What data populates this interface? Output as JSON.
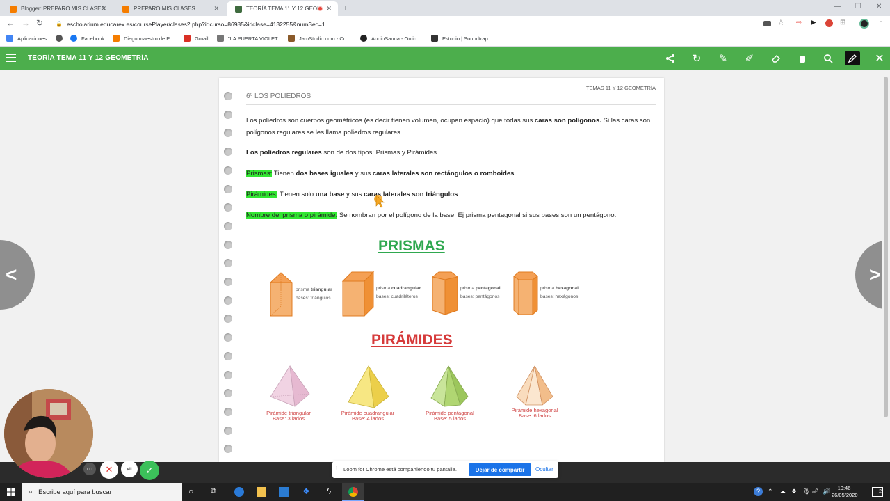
{
  "browser": {
    "tabs": [
      {
        "label": "Blogger: PREPARO MIS CLASES",
        "color": "#f57d00"
      },
      {
        "label": "PREPARO MIS CLASES",
        "color": "#f57d00"
      },
      {
        "label": "TEORÍA TEMA 11 Y 12 GEOM",
        "color": "#3f6b3f"
      }
    ],
    "url": "escholarium.educarex.es/coursePlayer/clases2.php?idcurso=86985&idclase=4132255&numSec=1",
    "bookmarks": [
      {
        "label": "Aplicaciones",
        "color": "#4285f4"
      },
      {
        "label": "",
        "color": "#555555"
      },
      {
        "label": "Facebook",
        "color": "#1877f2"
      },
      {
        "label": "Diego maestro de P...",
        "color": "#f57d00"
      },
      {
        "label": "Gmail",
        "color": "#d93025"
      },
      {
        "label": "\"LA PUERTA VIOLET...",
        "color": "#777777"
      },
      {
        "label": "JamStudio.com - Cr...",
        "color": "#8a5a2a"
      },
      {
        "label": "AudioSauna - Onlin...",
        "color": "#222222"
      },
      {
        "label": "Estudio | Soundtrap...",
        "color": "#333333"
      }
    ]
  },
  "app": {
    "title": "TEORÍA TEMA 11 Y 12 GEOMETRÍA",
    "accent": "#4cae4c",
    "toolbar_icons": [
      "share-icon",
      "refresh-icon",
      "pencil-icon",
      "marker-icon",
      "eraser-icon",
      "hand-icon",
      "search-icon",
      "pen-selected-icon",
      "close-icon"
    ]
  },
  "doc": {
    "section_title": "6º LOS POLIEDROS",
    "header_right": "TEMAS 11 Y 12 GEOMETRÍA",
    "p1": {
      "a": "Los poliedros son cuerpos geométricos (es decir tienen volumen, ocupan espacio) que todas sus ",
      "b": "caras son polígonos.",
      "c": " Si las caras son polígonos regulares se les llama poliedros regulares."
    },
    "p2": {
      "a": "Los poliedros regulares",
      "b": " son de dos tipos: Prismas y Pirámides."
    },
    "p3": {
      "hl": "Prismas:",
      "a": " Tienen ",
      "b": "dos bases iguales",
      "c": " y sus ",
      "d": "caras laterales son rectángulos o romboides"
    },
    "p4": {
      "hl": "Pirámides:",
      "a": " Tienen solo ",
      "b": "una base",
      "c": " y sus ",
      "d": "caras laterales son triángulos"
    },
    "p5": {
      "hl": "Nombre del prisma o pirámide:",
      "a": " Se nombran por el polígono de la base. Ej prisma pentagonal si sus bases son un pentágono."
    },
    "prismas_title": "PRISMAS",
    "prismas_color": "#2fa84f",
    "prisms": [
      {
        "name_pre": "prisma ",
        "name_bold": "triangular",
        "bases": "bases: triángulos"
      },
      {
        "name_pre": "prisma ",
        "name_bold": "cuadrangular",
        "bases": "bases: cuadriláteros"
      },
      {
        "name_pre": "prisma ",
        "name_bold": "pentagonal",
        "bases": "bases: pentágonos"
      },
      {
        "name_pre": "prisma ",
        "name_bold": "hexagonal",
        "bases": "bases: hexágonos"
      }
    ],
    "piramides_title": "PIRÁMIDES",
    "piramides_color": "#d63a3a",
    "pyramids": [
      {
        "name": "Pirámide triangular",
        "base": "Base: 3 lados",
        "color": "#efc6dc"
      },
      {
        "name": "Pirámide cuadrangular",
        "base": "Base: 4 lados",
        "color": "#f3df63"
      },
      {
        "name": "Pirámide pentagonal",
        "base": "Base: 5 lados",
        "color": "#b7da79"
      },
      {
        "name": "Pirámide hexagonal",
        "base": "Base: 6 lados",
        "color": "#f6cfa3"
      }
    ]
  },
  "loom": {
    "notice": "Loom for Chrome está compartiendo tu pantalla.",
    "stop_label": "Dejar de compartir",
    "hide_label": "Ocultar"
  },
  "taskbar": {
    "search_placeholder": "Escribe aquí para buscar",
    "time": "10:46",
    "date": "26/05/2020",
    "notifications": "2"
  }
}
